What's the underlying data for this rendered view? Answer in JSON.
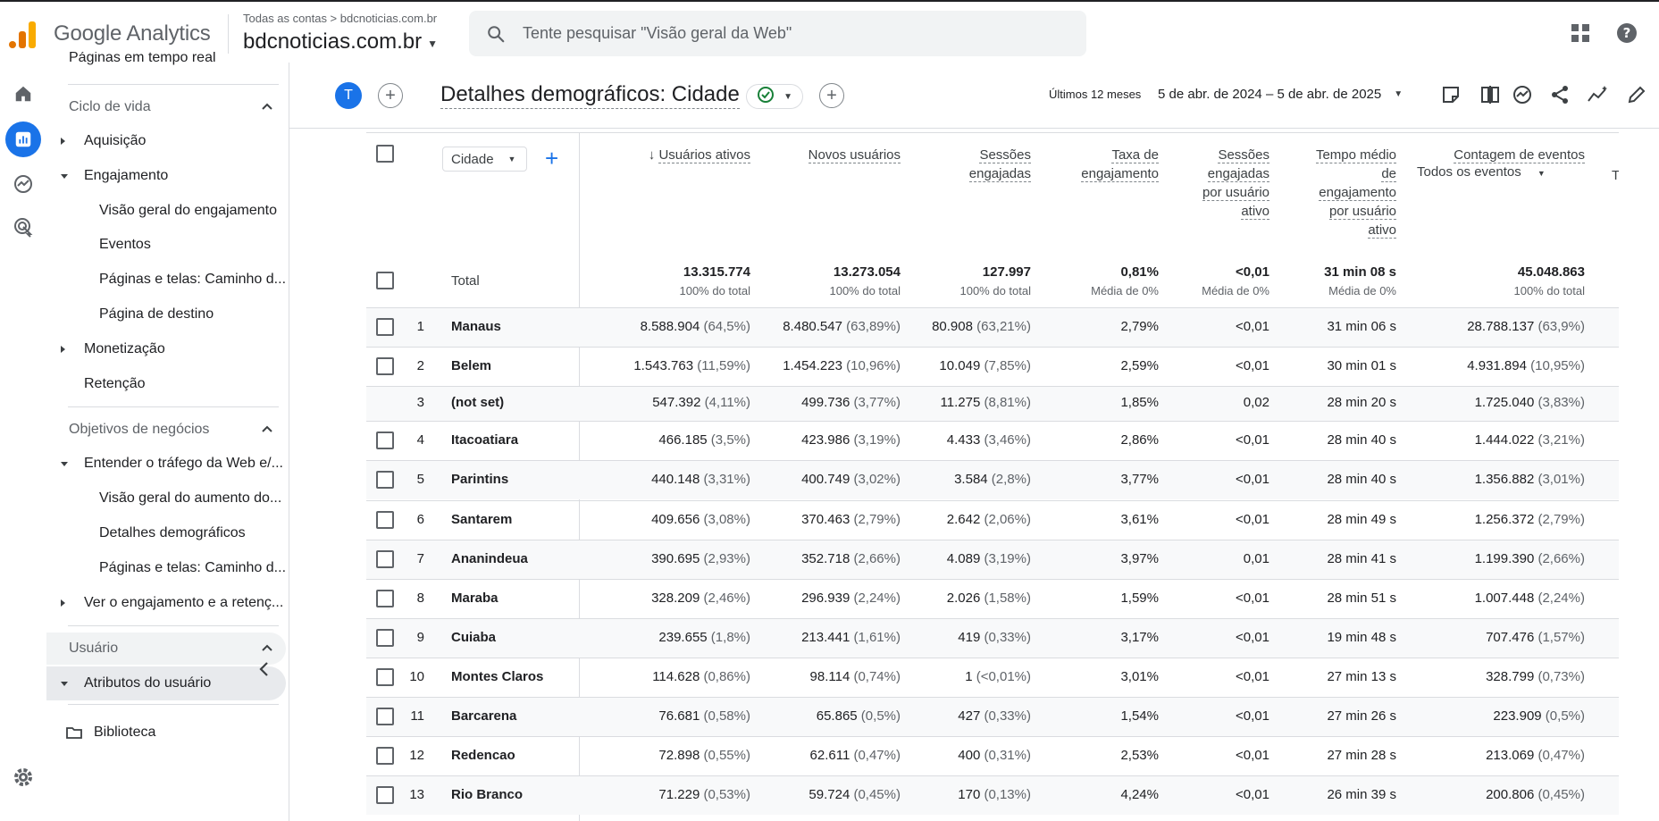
{
  "topbar": {
    "product_name": "Google Analytics",
    "account_crumb": "Todas as contas > bdcnoticias.com.br",
    "property_name": "bdcnoticias.com.br",
    "search_placeholder": "Tente pesquisar \"Visão geral da Web\"",
    "icons": [
      "apps-grid-icon",
      "help-icon"
    ]
  },
  "sidebar": {
    "truncated_top_item": "Páginas em tempo real",
    "section_lifecycle": "Ciclo de vida",
    "acquisition": "Aquisição",
    "engagement": "Engajamento",
    "engagement_overview": "Visão geral do engajamento",
    "events": "Eventos",
    "pages_screens": "Páginas e telas: Caminho d...",
    "landing_page": "Página de destino",
    "monetization": "Monetização",
    "retention": "Retenção",
    "section_business": "Objetivos de negócios",
    "understand_traffic": "Entender o tráfego da Web e/...",
    "growth_overview": "Visão geral do aumento do...",
    "demographic_details": "Detalhes demográficos",
    "pages_screens_2": "Páginas e telas: Caminho d...",
    "view_engagement": "Ver o engajamento e a retenç...",
    "section_user": "Usuário",
    "user_attributes": "Atributos do usuário",
    "library": "Biblioteca"
  },
  "report": {
    "avatar_letter": "T",
    "title": "Detalhes demográficos: Cidade",
    "date_label": "Últimos 12 meses",
    "date_value": "5 de abr. de 2024 – 5 de abr. de 2025"
  },
  "table": {
    "dimension": "Cidade",
    "columns": {
      "active_users": "Usuários ativos",
      "new_users": "Novos usuários",
      "engaged_sessions": [
        "Sessões",
        "engajadas"
      ],
      "engagement_rate": [
        "Taxa de",
        "engajamento"
      ],
      "sessions_per_user": [
        "Sessões",
        "engajadas",
        "por usuário",
        "ativo"
      ],
      "avg_time": [
        "Tempo médio",
        "de",
        "engajamento",
        "por usuário",
        "ativo"
      ],
      "event_count": "Contagem de eventos",
      "event_filter": "Todos os eventos",
      "next_col_clip": "T"
    },
    "total": {
      "label": "Total",
      "active_users": "13.315.774",
      "active_users_sub": "100% do total",
      "new_users": "13.273.054",
      "new_users_sub": "100% do total",
      "engaged_sessions": "127.997",
      "engaged_sessions_sub": "100% do total",
      "engagement_rate": "0,81%",
      "engagement_rate_sub": "Média de 0%",
      "sessions_per_user": "<0,01",
      "sessions_per_user_sub": "Média de 0%",
      "avg_time": "31 min 08 s",
      "avg_time_sub": "Média de 0%",
      "event_count": "45.048.863",
      "event_count_sub": "100% do total"
    },
    "rows": [
      {
        "idx": "1",
        "city": "Manaus",
        "au": "8.588.904",
        "au_p": "(64,5%)",
        "nu": "8.480.547",
        "nu_p": "(63,89%)",
        "es": "80.908",
        "es_p": "(63,21%)",
        "er": "2,79%",
        "spu": "<0,01",
        "time": "31 min 06 s",
        "ec": "28.788.137",
        "ec_p": "(63,9%)",
        "checkbox": true
      },
      {
        "idx": "2",
        "city": "Belem",
        "au": "1.543.763",
        "au_p": "(11,59%)",
        "nu": "1.454.223",
        "nu_p": "(10,96%)",
        "es": "10.049",
        "es_p": "(7,85%)",
        "er": "2,59%",
        "spu": "<0,01",
        "time": "30 min 01 s",
        "ec": "4.931.894",
        "ec_p": "(10,95%)",
        "checkbox": true
      },
      {
        "idx": "3",
        "city": "(not set)",
        "au": "547.392",
        "au_p": "(4,11%)",
        "nu": "499.736",
        "nu_p": "(3,77%)",
        "es": "11.275",
        "es_p": "(8,81%)",
        "er": "1,85%",
        "spu": "0,02",
        "time": "28 min 20 s",
        "ec": "1.725.040",
        "ec_p": "(3,83%)",
        "checkbox": false
      },
      {
        "idx": "4",
        "city": "Itacoatiara",
        "au": "466.185",
        "au_p": "(3,5%)",
        "nu": "423.986",
        "nu_p": "(3,19%)",
        "es": "4.433",
        "es_p": "(3,46%)",
        "er": "2,86%",
        "spu": "<0,01",
        "time": "28 min 40 s",
        "ec": "1.444.022",
        "ec_p": "(3,21%)",
        "checkbox": true
      },
      {
        "idx": "5",
        "city": "Parintins",
        "au": "440.148",
        "au_p": "(3,31%)",
        "nu": "400.749",
        "nu_p": "(3,02%)",
        "es": "3.584",
        "es_p": "(2,8%)",
        "er": "3,77%",
        "spu": "<0,01",
        "time": "28 min 40 s",
        "ec": "1.356.882",
        "ec_p": "(3,01%)",
        "checkbox": true
      },
      {
        "idx": "6",
        "city": "Santarem",
        "au": "409.656",
        "au_p": "(3,08%)",
        "nu": "370.463",
        "nu_p": "(2,79%)",
        "es": "2.642",
        "es_p": "(2,06%)",
        "er": "3,61%",
        "spu": "<0,01",
        "time": "28 min 49 s",
        "ec": "1.256.372",
        "ec_p": "(2,79%)",
        "checkbox": true
      },
      {
        "idx": "7",
        "city": "Ananindeua",
        "au": "390.695",
        "au_p": "(2,93%)",
        "nu": "352.718",
        "nu_p": "(2,66%)",
        "es": "4.089",
        "es_p": "(3,19%)",
        "er": "3,97%",
        "spu": "0,01",
        "time": "28 min 41 s",
        "ec": "1.199.390",
        "ec_p": "(2,66%)",
        "checkbox": true
      },
      {
        "idx": "8",
        "city": "Maraba",
        "au": "328.209",
        "au_p": "(2,46%)",
        "nu": "296.939",
        "nu_p": "(2,24%)",
        "es": "2.026",
        "es_p": "(1,58%)",
        "er": "1,59%",
        "spu": "<0,01",
        "time": "28 min 51 s",
        "ec": "1.007.448",
        "ec_p": "(2,24%)",
        "checkbox": true
      },
      {
        "idx": "9",
        "city": "Cuiaba",
        "au": "239.655",
        "au_p": "(1,8%)",
        "nu": "213.441",
        "nu_p": "(1,61%)",
        "es": "419",
        "es_p": "(0,33%)",
        "er": "3,17%",
        "spu": "<0,01",
        "time": "19 min 48 s",
        "ec": "707.476",
        "ec_p": "(1,57%)",
        "checkbox": true
      },
      {
        "idx": "10",
        "city": "Montes Claros",
        "au": "114.628",
        "au_p": "(0,86%)",
        "nu": "98.114",
        "nu_p": "(0,74%)",
        "es": "1",
        "es_p": "(<0,01%)",
        "er": "3,01%",
        "spu": "<0,01",
        "time": "27 min 13 s",
        "ec": "328.799",
        "ec_p": "(0,73%)",
        "checkbox": true
      },
      {
        "idx": "11",
        "city": "Barcarena",
        "au": "76.681",
        "au_p": "(0,58%)",
        "nu": "65.865",
        "nu_p": "(0,5%)",
        "es": "427",
        "es_p": "(0,33%)",
        "er": "1,54%",
        "spu": "<0,01",
        "time": "27 min 26 s",
        "ec": "223.909",
        "ec_p": "(0,5%)",
        "checkbox": true
      },
      {
        "idx": "12",
        "city": "Redencao",
        "au": "72.898",
        "au_p": "(0,55%)",
        "nu": "62.611",
        "nu_p": "(0,47%)",
        "es": "400",
        "es_p": "(0,31%)",
        "er": "2,53%",
        "spu": "<0,01",
        "time": "27 min 28 s",
        "ec": "213.069",
        "ec_p": "(0,47%)",
        "checkbox": true
      },
      {
        "idx": "13",
        "city": "Rio Branco",
        "au": "71.229",
        "au_p": "(0,53%)",
        "nu": "59.724",
        "nu_p": "(0,45%)",
        "es": "170",
        "es_p": "(0,13%)",
        "er": "4,24%",
        "spu": "<0,01",
        "time": "26 min 39 s",
        "ec": "200.806",
        "ec_p": "(0,45%)",
        "checkbox": true
      }
    ]
  },
  "colors": {
    "accent_blue": "#1a73e8",
    "logo_orange": "#e37400",
    "logo_yellow": "#f9ab00",
    "status_green": "#188038"
  }
}
